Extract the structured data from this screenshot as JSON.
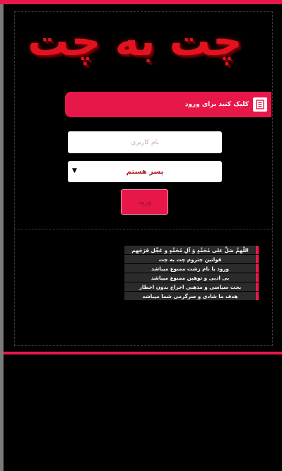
{
  "app": {
    "logo_text": "چت به چت"
  },
  "login": {
    "header_label": "کلیک کنید برای ورود",
    "header_icon": "login-icon",
    "username_placeholder": "نام کاربری",
    "username_value": "",
    "gender_selected": "پسر هستم",
    "submit_label": "ورود"
  },
  "rules": [
    "اللّهمَّ صَلِّ علی مُحَمَّدٍ وَ آلِ مُحَمَّدٍ و عَجِّل فَرَجَهم",
    "قوانین چتروم چت به چت",
    "ورود با نام زشت ممنوع میباشد",
    "بی ادبی و توهین ممنوع میباشد",
    "بحث سیاسی و مذهبی اخراج بدون اخطار",
    "هدف ما شادی و سرگرمی شما میباشد"
  ],
  "colors": {
    "accent": "#e8174a",
    "background": "#000000",
    "logo": "#e2121f"
  }
}
